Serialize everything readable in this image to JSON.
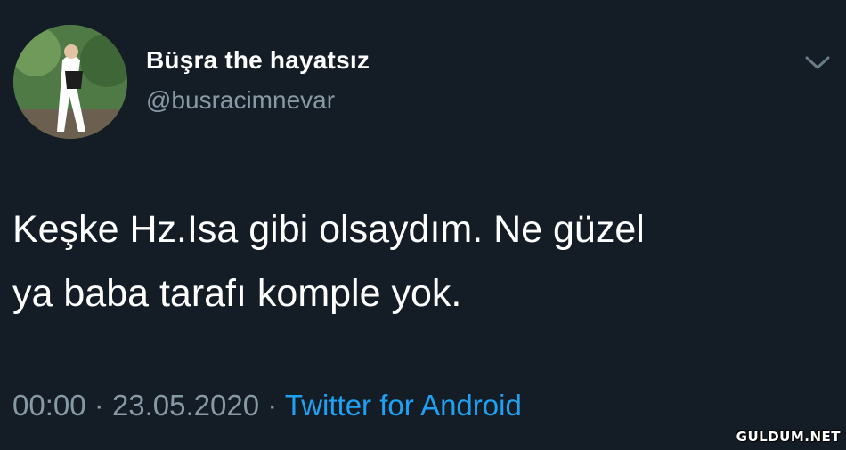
{
  "user": {
    "display_name": "Büşra the hayatsız",
    "handle": "@busracimnevar"
  },
  "tweet": {
    "lines": [
      "Keşke Hz.Isa gibi olsaydım. Ne güzel",
      "ya baba tarafı komple yok."
    ],
    "time": "00:00",
    "separator": "·",
    "date": "23.05.2020",
    "source": "Twitter for Android"
  },
  "icons": {
    "avatar": "profile-photo",
    "menu": "chevron-down-icon"
  },
  "watermark": "GULDUM.NET",
  "colors": {
    "background": "#141d26",
    "text": "#ffffff",
    "secondary": "#8899a6",
    "link": "#1da1f2"
  }
}
